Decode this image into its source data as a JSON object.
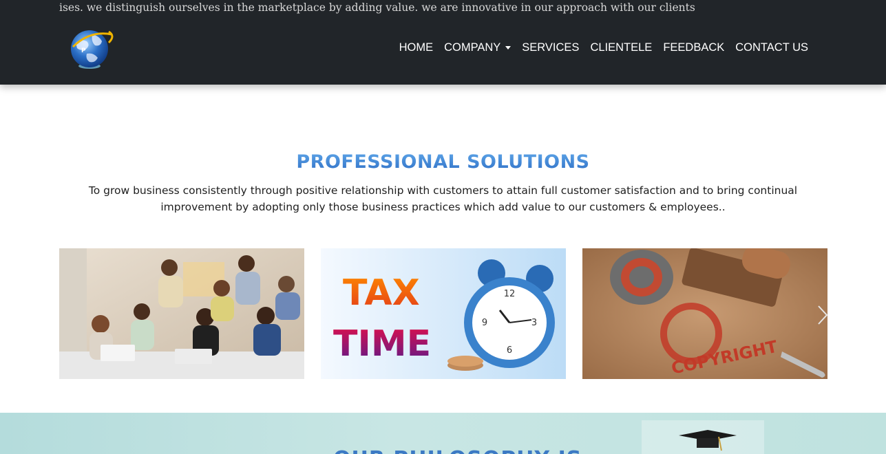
{
  "header": {
    "marquee_text": "ises. we distinguish ourselves in the marketplace by adding value. we are innovative in our approach with our clients",
    "nav": {
      "home": "HOME",
      "company": "COMPANY",
      "services": "SERVICES",
      "clientele": "CLIENTELE",
      "feedback": "FEEDBACK",
      "contact": "CONTACT US"
    }
  },
  "solutions": {
    "title": "PROFESSIONAL SOLUTIONS",
    "description": "To grow business consistently through positive relationship with customers to attain full customer satisfaction and to bring continual improvement by adopting only those business practices which add value to our customers & employees..",
    "cards": [
      {
        "alt": "team-meeting"
      },
      {
        "alt": "tax-time",
        "text_line1": "TAX",
        "text_line2": "TIME"
      },
      {
        "alt": "copyright-stamp",
        "stamp_text": "COPYRIGHT"
      }
    ]
  },
  "philosophy": {
    "title": "OUR PHILOSOPHY IS"
  },
  "colors": {
    "header_bg": "#212529",
    "accent_blue": "#3b79c4",
    "philosophy_bg": "#c8e6e4"
  }
}
